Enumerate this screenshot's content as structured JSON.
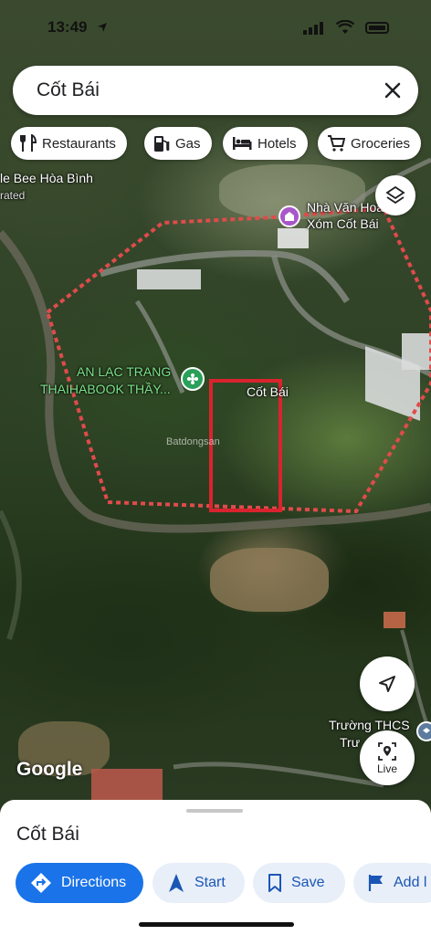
{
  "status_bar": {
    "time": "13:49"
  },
  "search": {
    "query": "Cốt Bái"
  },
  "chips": [
    {
      "label": "Restaurants",
      "icon": "fork-knife-icon"
    },
    {
      "label": "Gas",
      "icon": "gas-pump-icon"
    },
    {
      "label": "Hotels",
      "icon": "bed-icon"
    },
    {
      "label": "Groceries",
      "icon": "cart-icon"
    }
  ],
  "map": {
    "labels": {
      "bee": "le Bee Hòa Bình",
      "rated": "rated",
      "nha_van_hoa_1": "Nhà Văn Hoá",
      "nha_van_hoa_2": "Xóm Cốt Bái",
      "an_lac_1": "AN LẠC TRANG",
      "an_lac_2": "THAIHABOOK THẦY...",
      "cot_bai": "Cốt Bái",
      "truong_1": "Trường THCS",
      "truong_2": "Trư"
    },
    "google_logo": "Google",
    "watermark": "Batdongsan",
    "live_label": "Live",
    "boundary_color": "#e04b4b",
    "highlight_color": "#d9232e"
  },
  "sheet": {
    "place_name": "Cốt Bái",
    "actions": [
      {
        "label": "Directions",
        "icon": "directions-icon"
      },
      {
        "label": "Start",
        "icon": "navigation-arrow-icon"
      },
      {
        "label": "Save",
        "icon": "bookmark-icon"
      },
      {
        "label": "Add l",
        "icon": "flag-icon"
      }
    ]
  }
}
